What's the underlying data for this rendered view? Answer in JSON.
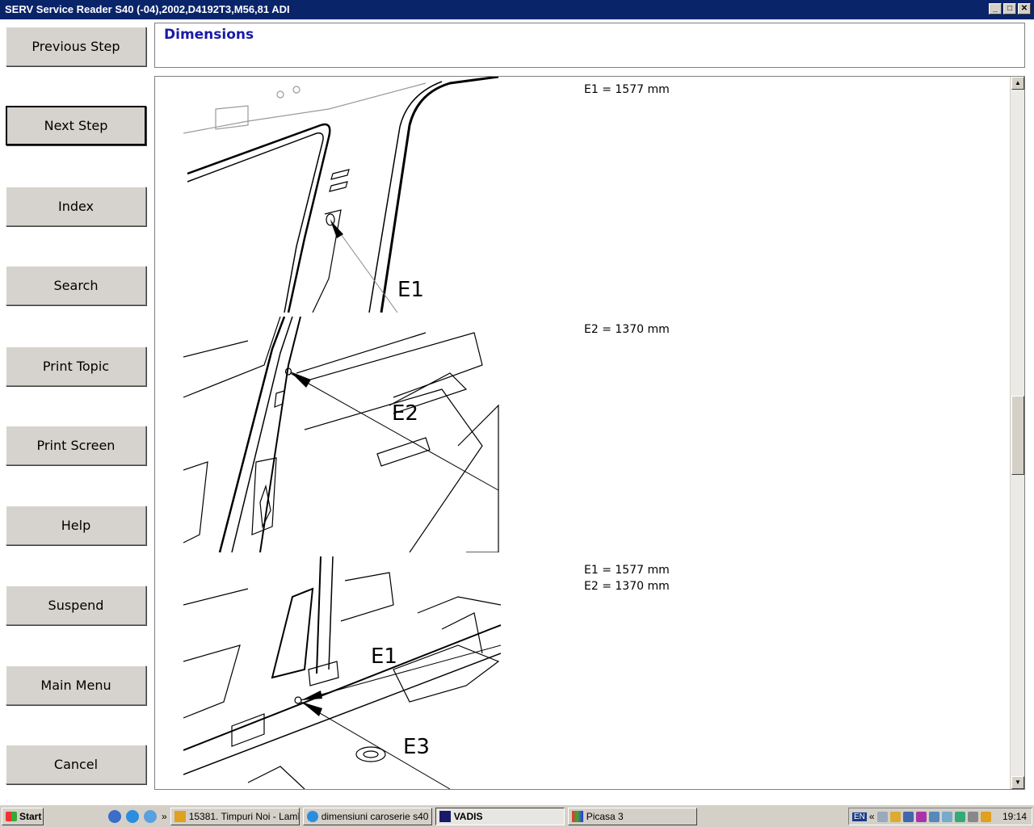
{
  "window": {
    "title": "SERV Service Reader S40 (-04),2002,D4192T3,M56,81 ADI"
  },
  "nav": {
    "previous_step": "Previous Step",
    "next_step": "Next Step",
    "index": "Index",
    "search": "Search",
    "print_topic": "Print Topic",
    "print_screen": "Print Screen",
    "help": "Help",
    "suspend": "Suspend",
    "main_menu": "Main Menu",
    "cancel": "Cancel"
  },
  "header": {
    "title": "Dimensions"
  },
  "content": {
    "section1": {
      "lines": [
        "E1 = 1577 mm"
      ],
      "callouts": [
        "E1"
      ]
    },
    "section2": {
      "lines": [
        "E2 = 1370 mm"
      ],
      "callouts": [
        "E2"
      ]
    },
    "section3": {
      "lines": [
        "E1 = 1577 mm",
        "E2 = 1370 mm"
      ],
      "callouts": [
        "E1",
        "E3"
      ]
    }
  },
  "taskbar": {
    "start": "Start",
    "tasks": [
      {
        "label": "15381. Timpuri Noi - Lamî...",
        "icon": "winamp-icon"
      },
      {
        "label": "dimensiuni caroserie s40 ...",
        "icon": "ie-icon"
      },
      {
        "label": "VADIS",
        "icon": "vadis-icon",
        "active": true
      },
      {
        "label": "Picasa 3",
        "icon": "picasa-icon"
      }
    ],
    "language": "EN",
    "clock": "19:14"
  }
}
